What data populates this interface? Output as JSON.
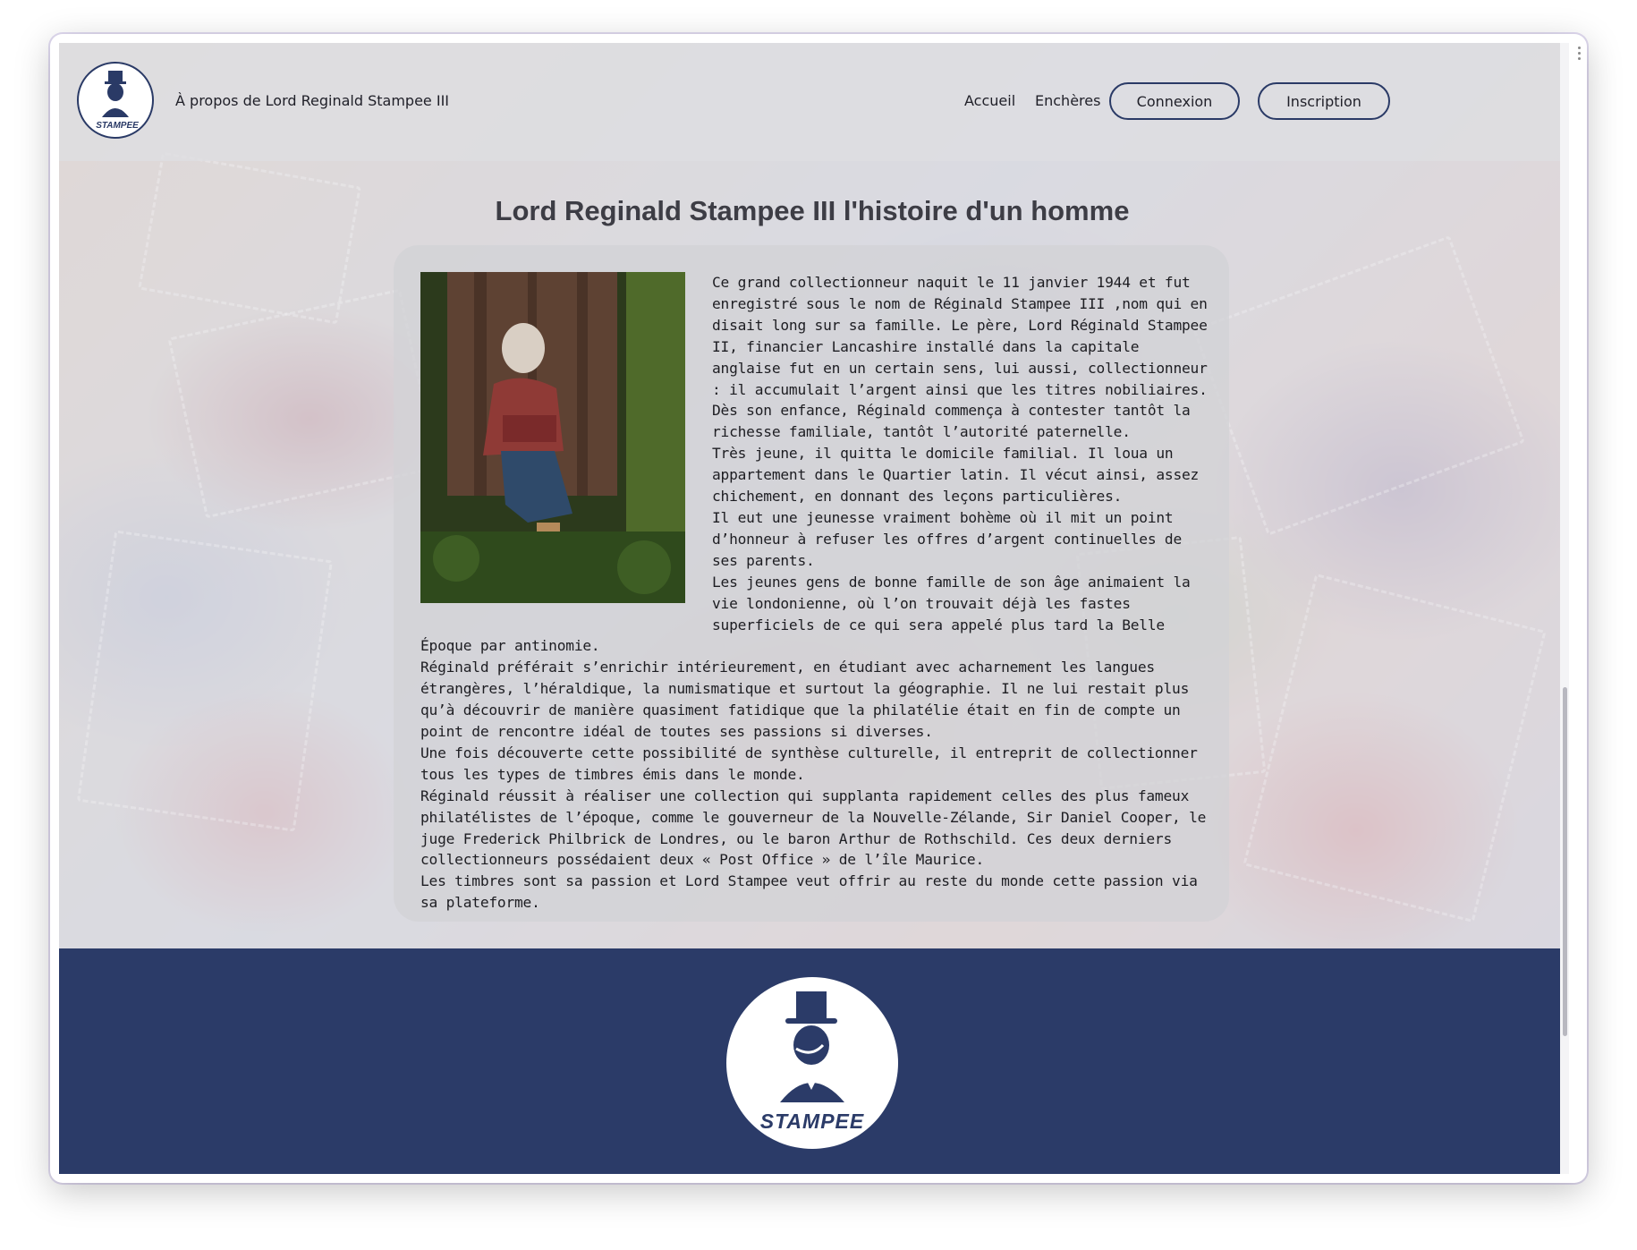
{
  "header": {
    "brand_text": "À propos de Lord Reginald Stampee III",
    "logo_text": "STAMPEE",
    "nav": {
      "accueil": "Accueil",
      "encheres": "Enchères",
      "connexion": "Connexion",
      "inscription": "Inscription"
    }
  },
  "main": {
    "title": "Lord Reginald Stampee III l'histoire d'un homme",
    "paragraphs": [
      "Ce grand collectionneur naquit le 11 janvier 1944 et fut enregistré sous le nom de Réginald Stampee III ,nom qui en disait long sur sa famille. Le père, Lord Réginald Stampee II, financier Lancashire installé dans la capitale anglaise fut en un certain sens, lui aussi, collectionneur : il accumulait l’argent ainsi que les titres nobiliaires.",
      "Dès son enfance, Réginald commença à contester tantôt la richesse familiale, tantôt l’autorité paternelle.",
      "Très jeune, il quitta le domicile familial. Il loua un appartement dans le Quartier latin. Il vécut ainsi, assez chichement, en donnant des leçons particulières.",
      "Il eut une jeunesse vraiment bohème où il mit un point d’honneur à refuser les offres d’argent continuelles de ses parents.",
      "Les jeunes gens de bonne famille de son âge animaient la vie londonienne, où l’on trouvait déjà les fastes superficiels de ce qui sera appelé plus tard la Belle Époque par antinomie.",
      "Réginald préférait s’enrichir intérieurement, en étudiant avec acharnement les langues étrangères, l’héraldique, la numismatique et surtout la géographie. Il ne lui restait plus qu’à découvrir de manière quasiment fatidique que la philatélie était en fin de compte un point de rencontre idéal de toutes ses passions si diverses.",
      "Une fois découverte cette possibilité de synthèse culturelle, il entreprit de collectionner tous les types de timbres émis dans le monde.",
      "Réginald réussit à réaliser une collection qui supplanta rapidement celles des plus fameux philatélistes de l’époque, comme le gouverneur de la Nouvelle-Zélande, Sir Daniel Cooper, le juge Frederick Philbrick de Londres, ou le baron Arthur de Rothschild. Ces deux derniers collectionneurs possédaient deux « Post Office » de l’île Maurice.",
      "Les timbres sont sa passion et Lord Stampee veut offrir au reste du monde cette passion via sa plateforme."
    ]
  },
  "footer": {
    "logo_text": "STAMPEE"
  },
  "colors": {
    "brand_navy": "#2b3b68",
    "text_dark": "#1d1d22",
    "title_gray": "#3d3d45"
  }
}
